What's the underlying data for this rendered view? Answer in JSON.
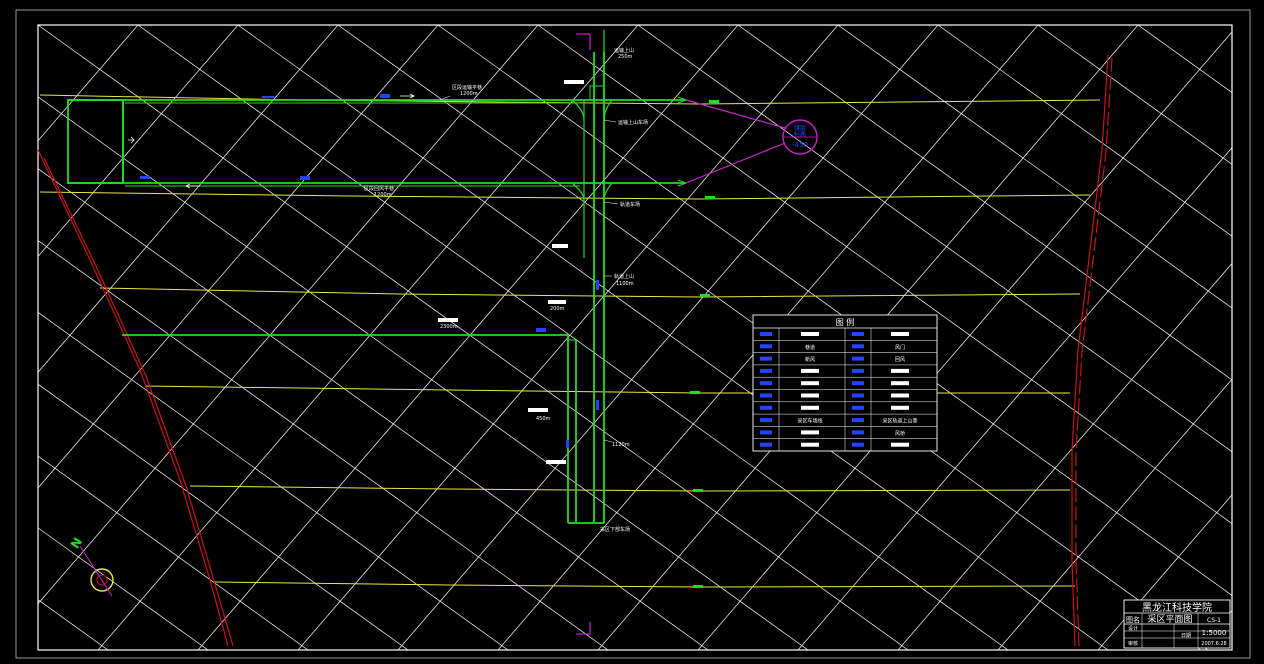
{
  "drawing": {
    "title_block": {
      "school": "黑龙江科技学院",
      "drawing_name_label": "图名",
      "drawing_name": "采区平面图",
      "drawing_no": "CS-1",
      "scale": "1:5000",
      "design_label": "设计",
      "check_label": "审核",
      "date_label": "日期",
      "date": "2007.6.28"
    },
    "legend": {
      "title": "图  例",
      "rows": [
        {
          "left_symbol": "shaft-icon",
          "left_text": "",
          "right_symbol": "fan-icon",
          "right_text": ""
        },
        {
          "left_symbol": "arrow-line-icon",
          "left_text": "巷道",
          "right_symbol": "door-icon",
          "right_text": "风门"
        },
        {
          "left_symbol": "fresh-air-arrow-icon",
          "left_text": "新风",
          "right_symbol": "return-air-icon",
          "right_text": "回风"
        },
        {
          "left_symbol": "pipe-icon",
          "left_text": "",
          "right_symbol": "pump-icon",
          "right_text": ""
        },
        {
          "left_symbol": "sensor-icon",
          "left_text": "",
          "right_symbol": "station-icon",
          "right_text": ""
        },
        {
          "left_symbol": "gauge-icon",
          "left_text": "",
          "right_symbol": "lamp-icon",
          "right_text": ""
        },
        {
          "left_symbol": "tag-icon",
          "left_text": "",
          "right_symbol": "marker-icon",
          "right_text": ""
        },
        {
          "left_symbol": "bracket-icon",
          "left_text": "采区车场线",
          "right_symbol": "box-icon",
          "right_text": "采区轨道上山巷"
        },
        {
          "left_symbol": "seal-icon",
          "left_text": "",
          "right_symbol": "cross-icon",
          "right_text": "风桥"
        },
        {
          "left_symbol": "drain-icon",
          "left_text": "",
          "right_symbol": "flag-icon",
          "right_text": ""
        }
      ]
    },
    "roadway_labels": {
      "upper_gate": "区段运输平巷",
      "upper_gate_len": "1200m",
      "lower_gate": "区段回风平巷",
      "lower_gate_len": "1200m",
      "top_hill": "运输上山",
      "top_hill_len": "250m",
      "middle_hill": "轨道上山",
      "middle_hill_len": "1100m",
      "left_drift": "2300m",
      "len_450": "450m",
      "len_1120": "1120m",
      "len_200": "200m",
      "tag_upper_junction": "运输上山车场",
      "tag_lower_junction": "轨道车场",
      "tag_bottom": "采区下部车场"
    },
    "callout": {
      "line1": "煤层",
      "line2": "标高",
      "line3": "-450"
    },
    "north_arrow_label": "N",
    "colors": {
      "background": "#000000",
      "border": "#ffffff",
      "grid": "#ffffff",
      "contour": "#e8e84a",
      "roadway": "#22dd22",
      "fault": "#cc1111",
      "callout": "#cc22cc",
      "blue_marks": "#2244ff"
    }
  }
}
